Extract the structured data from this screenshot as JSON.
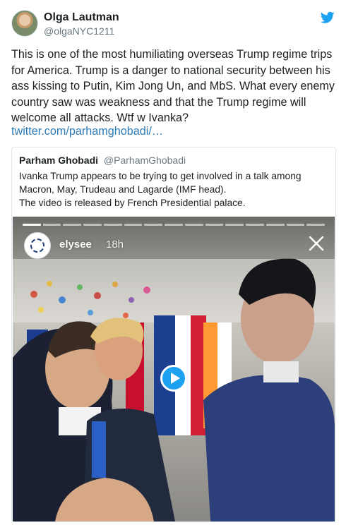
{
  "tweet": {
    "author_name": "Olga Lautman",
    "author_handle": "@olgaNYC1211",
    "text": "This is one of the most humiliating overseas Trump regime trips for America. Trump is a danger to national security between his ass kissing to Putin, Kim Jong Un, and MbS. What every enemy country saw was weakness and that the Trump regime will welcome all attacks. Wtf w Ivanka?",
    "link_text": "twitter.com/parhamghobadi/…",
    "brand_icon": "twitter-bird-icon",
    "colors": {
      "link": "#2b7bb9",
      "brand": "#1da1f2",
      "muted": "#697882"
    }
  },
  "quoted": {
    "author_name": "Parham Ghobadi",
    "author_handle": "@ParhamGhobadi",
    "text_line1": "Ivanka Trump appears to be trying to get involved in a talk among Macron, May, Trudeau and Lagarde (IMF head).",
    "text_line2": "The video is released by French Presidential palace."
  },
  "video": {
    "story_account": "elysee",
    "story_time": "18h",
    "progress_segments_total": 15,
    "progress_segments_done": 1,
    "icons": [
      "elysee-logo-icon",
      "close-icon",
      "play-icon"
    ]
  }
}
